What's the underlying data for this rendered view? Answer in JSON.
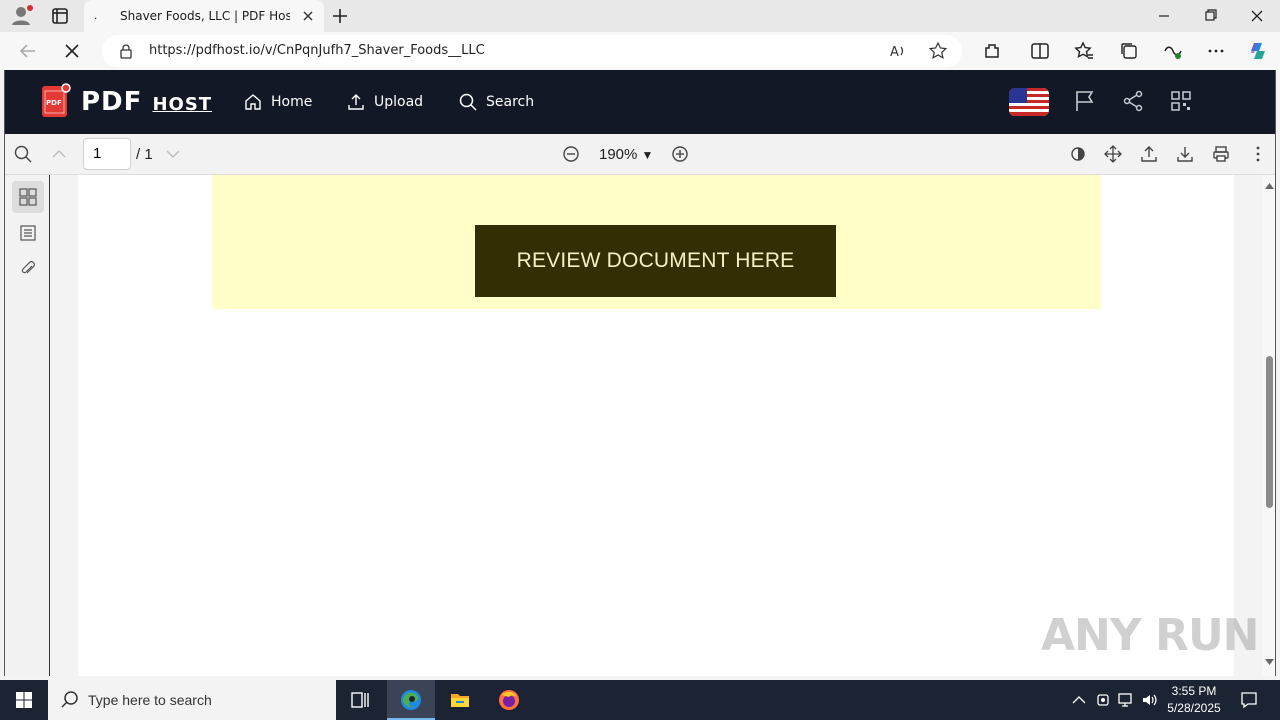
{
  "browser": {
    "tab": {
      "title": "Shaver Foods, LLC | PDF Host",
      "favicon": "."
    },
    "url": "https://pdfhost.io/v/CnPqnJufh7_Shaver_Foods__LLC"
  },
  "site": {
    "logo": {
      "main": "PDF",
      "sub": "HOST",
      "badge": "PDF"
    },
    "nav": [
      {
        "label": "Home",
        "icon": "home-icon"
      },
      {
        "label": "Upload",
        "icon": "upload-icon"
      },
      {
        "label": "Search",
        "icon": "search-icon"
      }
    ],
    "header_icons": [
      "us-flag-icon",
      "flag-icon",
      "share-icon",
      "qr-code-icon"
    ]
  },
  "pdf_toolbar": {
    "page_current": "1",
    "page_total": "/ 1",
    "zoom": "190%",
    "zoom_caret": "▼"
  },
  "document": {
    "button_label": "REVIEW DOCUMENT HERE",
    "banner_color": "#fffdc8",
    "button_color": "#332f05"
  },
  "watermark": "ANY RUN",
  "taskbar": {
    "search_placeholder": "Type here to search",
    "time": "3:55 PM",
    "date": "5/28/2025"
  },
  "colors": {
    "header_bg": "#121826",
    "taskbar_bg": "#1c2333",
    "logo_red": "#e53935"
  }
}
